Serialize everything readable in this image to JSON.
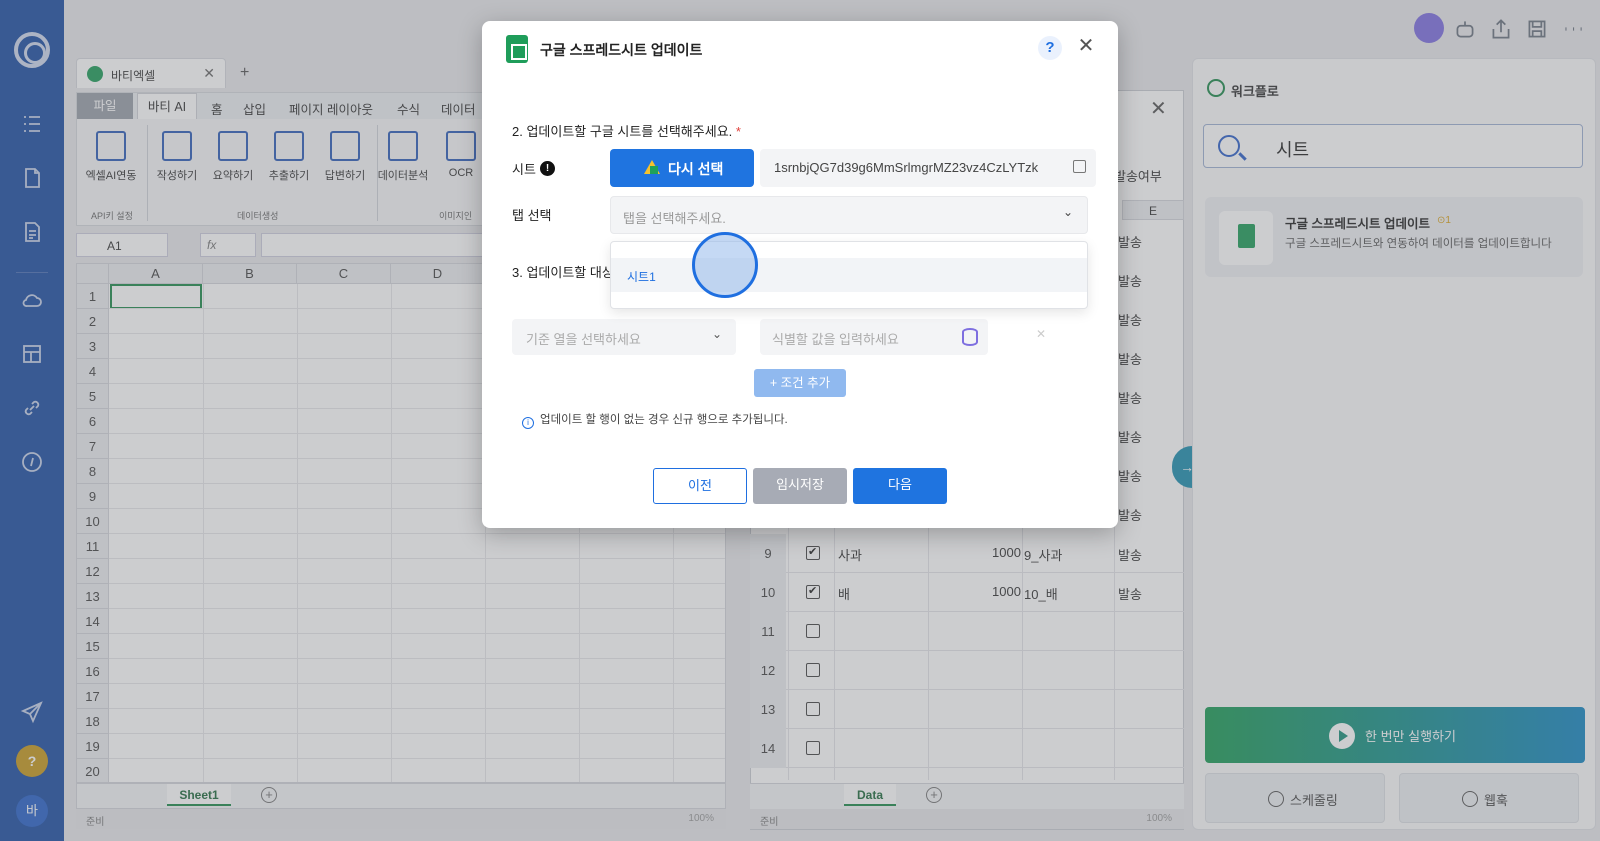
{
  "left_rail": {
    "help_label": "?",
    "avatar_label": "바"
  },
  "excel_window": {
    "doc_tab_title": "바티엑셀",
    "new_tab": "+",
    "menu": [
      "파일",
      "바티 AI",
      "홈",
      "삽입",
      "페이지 레이아웃",
      "수식",
      "데이터"
    ],
    "ribbon_buttons": [
      "엑셀AI연동",
      "작성하기",
      "요약하기",
      "추출하기",
      "답변하기",
      "데이터분석",
      "OCR"
    ],
    "ribbon_groups": [
      "API키 설정",
      "데이터생성",
      "이미지인"
    ],
    "name_box": "A1",
    "fx": "fx",
    "columns": [
      "A",
      "B",
      "C",
      "D"
    ],
    "rows": [
      "1",
      "2",
      "3",
      "4",
      "5",
      "6",
      "7",
      "8",
      "9",
      "10",
      "11",
      "12",
      "13",
      "14",
      "15",
      "16",
      "17",
      "18",
      "19",
      "20"
    ],
    "sheet_tab": "Sheet1",
    "status": "준비",
    "zoom": "100%"
  },
  "data_window": {
    "header_label": "발송여부",
    "col_e": "E",
    "rows": [
      {
        "n": "9",
        "checked": true,
        "name": "사과",
        "value": "1000",
        "key": "9_사과",
        "status": "발송"
      },
      {
        "n": "10",
        "checked": true,
        "name": "배",
        "value": "1000",
        "key": "10_배",
        "status": "발송"
      },
      {
        "n": "11",
        "checked": false,
        "name": "",
        "value": "",
        "key": "",
        "status": ""
      },
      {
        "n": "12",
        "checked": false,
        "name": "",
        "value": "",
        "key": "",
        "status": ""
      },
      {
        "n": "13",
        "checked": false,
        "name": "",
        "value": "",
        "key": "",
        "status": ""
      },
      {
        "n": "14",
        "checked": false,
        "name": "",
        "value": "",
        "key": "",
        "status": ""
      }
    ],
    "status_column_above": [
      "발송",
      "발송",
      "발송",
      "발송",
      "발송",
      "발송",
      "발송",
      "발송"
    ],
    "sheet_tab": "Data",
    "status": "준비",
    "zoom": "100%"
  },
  "workflow_panel": {
    "title": "워크플로",
    "search_value": "시트",
    "card_title": "구글 스프레드시트 업데이트",
    "card_badge": "1",
    "card_desc": "구글 스프레드시트와 연동하여 데이터를 업데이트합니다",
    "run_once_label": "한 번만 실행하기",
    "schedule_label": "스케줄링",
    "webhook_label": "웹훅"
  },
  "modal": {
    "title": "구글 스프레드시트 업데이트",
    "help": "?",
    "close": "✕",
    "step2_label": "2. 업데이트할 구글 시트를 선택해주세요.",
    "required_mark": "*",
    "sheet_label": "시트",
    "reselect_label": "다시 선택",
    "sheet_url": "1srnbjQG7d39g6MmSrlmgrMZ23vz4CzLYTzk",
    "tab_label": "탭 선택",
    "tab_placeholder": "탭을 선택해주세요.",
    "dropdown_options": [
      "시트1"
    ],
    "step3_label": "3. 업데이트할 대상",
    "column_placeholder": "기준 열을 선택하세요",
    "value_placeholder": "식별할 값을 입력하세요",
    "add_condition_label": "+ 조건 추가",
    "note": "업데이트 할 행이 없는 경우 신규 행으로 추가됩니다.",
    "prev_label": "이전",
    "temp_save_label": "임시저장",
    "next_label": "다음"
  },
  "colors": {
    "rail": "#1e4fa3",
    "primary": "#1f74e0",
    "sheets_green": "#1f9d5a",
    "required": "#e0413b"
  }
}
